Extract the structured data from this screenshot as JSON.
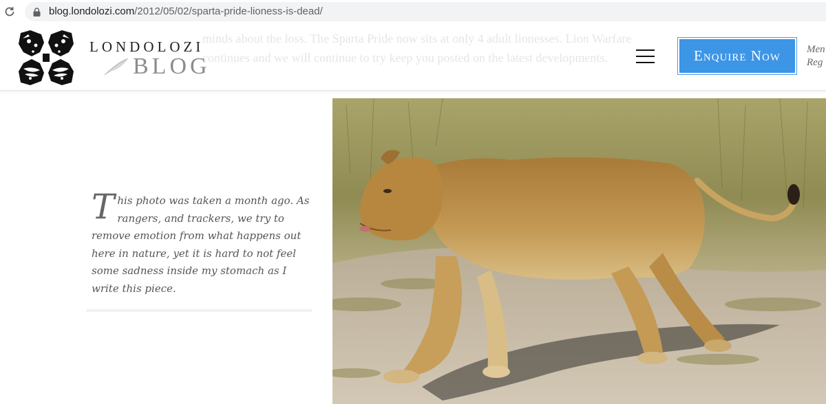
{
  "browser": {
    "url_domain": "blog.londolozi.com",
    "url_path": "/2012/05/02/sparta-pride-lioness-is-dead/",
    "reload_icon": "reload-icon",
    "lock_icon": "lock-icon"
  },
  "header": {
    "behind_text_line1": "minds about the loss. The Sparta Pride now sits at only 4 adult lionesses. Lion Warfare",
    "behind_text_line2": "continues and we will continue to try keep you posted on the latest developments.",
    "logo_top": "LONDOLOZI",
    "logo_bottom": "BLOG",
    "menu_icon": "hamburger-menu-icon",
    "enquire_label": "Enquire Now",
    "side_line1": "Men",
    "side_line2": "Reg"
  },
  "article": {
    "drop_cap": "T",
    "quote_text": "his photo was taken a month ago. As rangers, and trackers, we try to remove emotion from what happens out here in nature, yet it is hard to not feel some sadness inside my stomach as I write this piece.",
    "photo_subject": "lioness-walking-photo"
  },
  "colors": {
    "enquire_bg": "#3d95e6",
    "logo_grey": "#8c8c8c",
    "quote_text": "#555555"
  }
}
